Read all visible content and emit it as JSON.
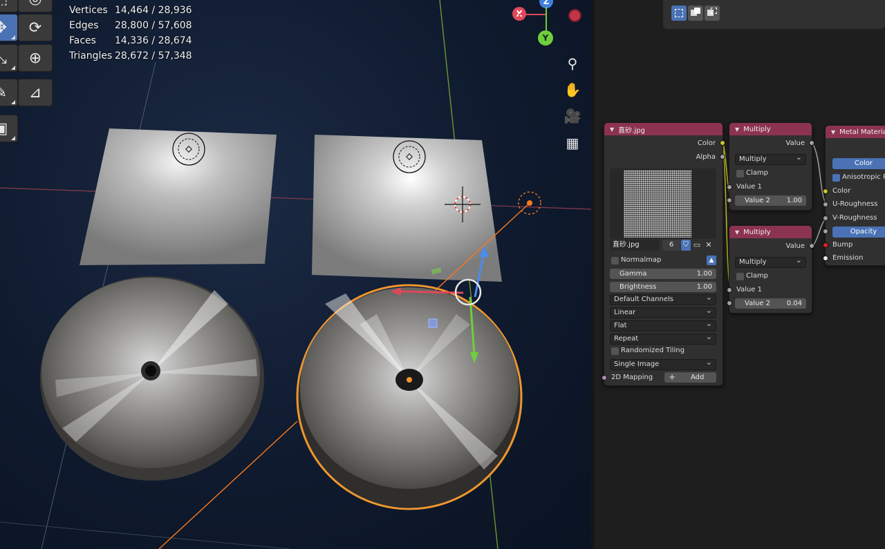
{
  "stats": {
    "vertices_label": "Vertices",
    "vertices": "14,464 / 28,936",
    "edges_label": "Edges",
    "edges": "28,800 / 57,608",
    "faces_label": "Faces",
    "faces": "14,336 / 28,674",
    "triangles_label": "Triangles",
    "triangles": "28,672 / 57,348"
  },
  "toolbar": {
    "tools": [
      "select-icon",
      "move-icon",
      "rotate-icon",
      "scale-icon",
      "transform-icon",
      "annotate-icon",
      "measure-icon",
      "add-cube-icon"
    ]
  },
  "gizmo": {
    "x": "X",
    "y": "Y",
    "z": "Z"
  },
  "nav_icons": [
    "zoom-icon",
    "pan-hand-icon",
    "camera-icon",
    "grid-icon"
  ],
  "colors": {
    "node_header": "#8c3352",
    "accent_blue": "#4a72b5",
    "selection_orange": "#f0962e",
    "viewport_bg": "#0f1a2e"
  },
  "image_node": {
    "title": "直砂.jpg",
    "out_color": "Color",
    "out_alpha": "Alpha",
    "image_name": "直砂.jpg",
    "users": "6",
    "normalmap": "Normalmap",
    "gamma_label": "Gamma",
    "gamma": "1.00",
    "brightness_label": "Brightness",
    "brightness": "1.00",
    "channels": "Default Channels",
    "interpolation": "Linear",
    "projection": "Flat",
    "extension": "Repeat",
    "randomized_tiling": "Randomized Tiling",
    "source": "Single Image",
    "mapping": "2D Mapping",
    "add": "Add"
  },
  "multiply1": {
    "title": "Multiply",
    "out_value": "Value",
    "operation": "Multiply",
    "clamp": "Clamp",
    "value1": "Value 1",
    "value2_label": "Value 2",
    "value2": "1.00"
  },
  "multiply2": {
    "title": "Multiply",
    "out_value": "Value",
    "operation": "Multiply",
    "clamp": "Clamp",
    "value1": "Value 1",
    "value2_label": "Value 2",
    "value2": "0.04"
  },
  "metal_node": {
    "title": "Metal Material",
    "color_btn": "Color",
    "anisotropic": "Anisotropic Rou",
    "in_color": "Color",
    "in_u_rough": "U-Roughness",
    "in_v_rough": "V-Roughness",
    "opacity_btn": "Opacity",
    "in_bump": "Bump",
    "in_emission": "Emission"
  }
}
